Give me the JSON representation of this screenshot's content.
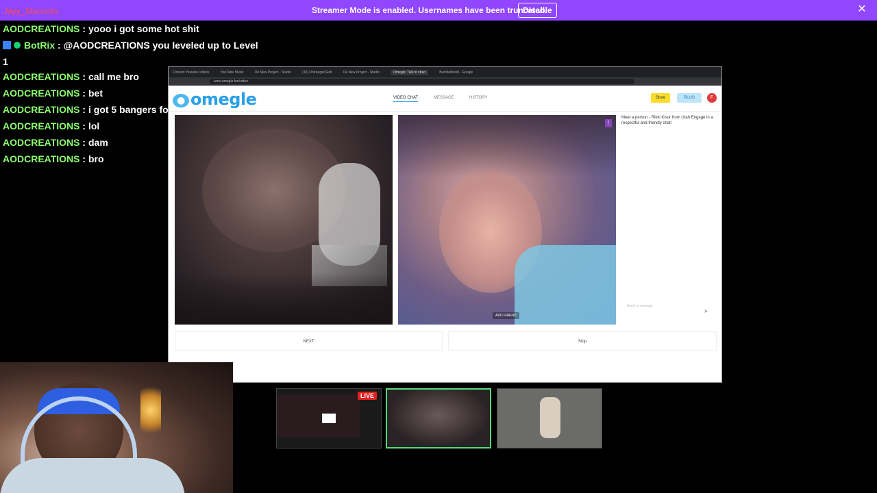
{
  "banner": {
    "message": "Streamer Mode is enabled. Usernames have been truncated.",
    "disable_label": "Disable",
    "close_glyph": "✕"
  },
  "chat": {
    "top_user": "Jayy_Stacocks",
    "lines": [
      {
        "user": "Jayy_Stacocks",
        "sep": " : ",
        "text": "",
        "emojis": "✱ ✱ ✱ ✱ ✱ ✱ ✱ ✱",
        "color": "#ff3b3b"
      },
      {
        "user": "AODCREATIONS",
        "sep": " : ",
        "text": "yooo i got some hot shit"
      },
      {
        "user": "BotRix",
        "sep": " : ",
        "text": "@AODCREATIONS you leveled up to Level"
      },
      {
        "user": "",
        "sep": "",
        "text": "1"
      },
      {
        "user": "AODCREATIONS",
        "sep": " : ",
        "text": "call me bro"
      },
      {
        "user": "AODCREATIONS",
        "sep": " : ",
        "text": "bet"
      },
      {
        "user": "AODCREATIONS",
        "sep": " : ",
        "text": "i got 5 bangers for u"
      },
      {
        "user": "AODCREATIONS",
        "sep": " : ",
        "text": "lol"
      },
      {
        "user": "AODCREATIONS",
        "sep": " : ",
        "text": "dam"
      },
      {
        "user": "AODCREATIONS",
        "sep": " : ",
        "text": "bro"
      }
    ]
  },
  "browser": {
    "tabs": [
      "Convert Youtube Videos",
      "YouTube Music",
      "Ok New Project - Studio",
      "(15) Untranged Edit",
      "Ok New Project - Studio",
      "Omegle: Talk to stran",
      "BuddleWorld - Google"
    ],
    "active_tab": 5,
    "url": "www.omegle.fun/video",
    "logo": "omegle",
    "nav": {
      "video_chat": "VIDEO CHAT",
      "message": "MESSAGE",
      "history": "HISTORY"
    },
    "store_label": "Store",
    "plus_label": "PLUS",
    "profile_initial": "F",
    "info_text": "Meet a person - Rikki Kisor from Utah Engage in a respectful and friendly chat!",
    "add_friend": "ADD FRIEND",
    "input_placeholder": "Send a message",
    "next_label": "NEXT",
    "stop_label": "Stop"
  },
  "scenes": {
    "live_label": "LIVE"
  }
}
